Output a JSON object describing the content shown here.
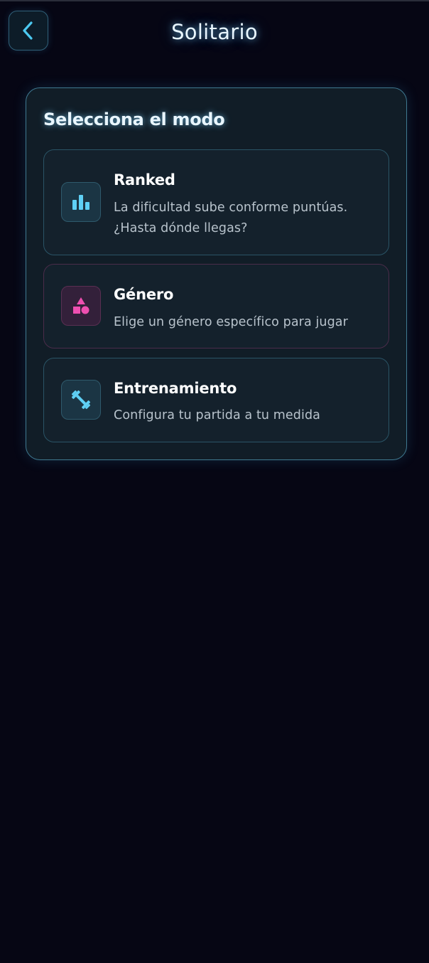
{
  "header": {
    "title": "Solitario",
    "back_icon": "chevron-left-icon"
  },
  "colors": {
    "background": "#060614",
    "accent_cyan": "#4cc8f0",
    "accent_pink": "#ee4fb0",
    "panel": "#111d27",
    "card": "#14212c"
  },
  "mode_panel": {
    "title": "Selecciona el modo",
    "modes": [
      {
        "title": "Ranked",
        "description": "La dificultad sube conforme puntúas. ¿Hasta dónde llegas?",
        "icon": "bar-chart-icon"
      },
      {
        "title": "Género",
        "description": "Elige un género específico para jugar",
        "icon": "shapes-icon"
      },
      {
        "title": "Entrenamiento",
        "description": "Configura tu partida a tu medida",
        "icon": "dumbbell-icon"
      }
    ]
  }
}
